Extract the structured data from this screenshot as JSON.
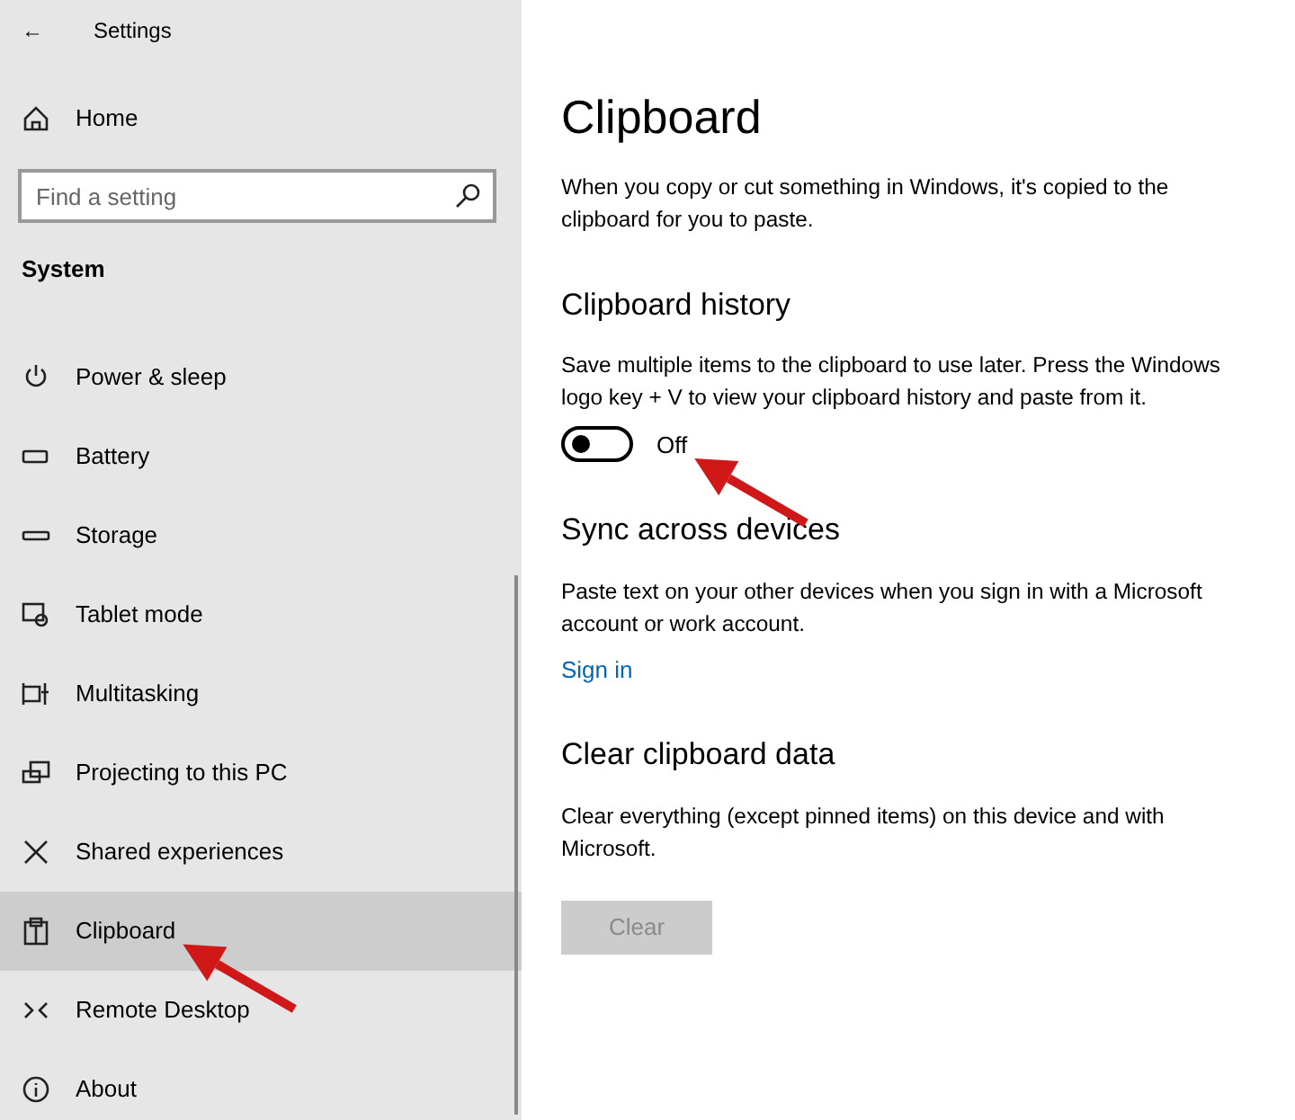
{
  "window": {
    "title": "Settings",
    "back": "←"
  },
  "sidebar": {
    "home": "Home",
    "search": {
      "placeholder": "Find a setting"
    },
    "section": "System",
    "items": [
      {
        "label": "Power & sleep",
        "selected": false
      },
      {
        "label": "Battery",
        "selected": false
      },
      {
        "label": "Storage",
        "selected": false
      },
      {
        "label": "Tablet mode",
        "selected": false
      },
      {
        "label": "Multitasking",
        "selected": false
      },
      {
        "label": "Projecting to this PC",
        "selected": false
      },
      {
        "label": "Shared experiences",
        "selected": false
      },
      {
        "label": "Clipboard",
        "selected": true,
        "callout": true
      },
      {
        "label": "Remote Desktop",
        "selected": false
      },
      {
        "label": "About",
        "selected": false
      }
    ]
  },
  "page": {
    "title": "Clipboard",
    "intro": "When you copy or cut something in Windows, it's copied to the clipboard for you to paste.",
    "sections": [
      {
        "kind": "toggle",
        "heading": "Clipboard history",
        "text": "Save multiple items to the clipboard to use later. Press the Windows logo key + V to view your clipboard history and paste from it.",
        "on": false,
        "state_label": "Off",
        "callout": true
      },
      {
        "kind": "link",
        "heading": "Sync across devices",
        "text": "Paste text on your other devices when you sign in with a Microsoft account or work account.",
        "link": "Sign in"
      },
      {
        "kind": "button",
        "heading": "Clear clipboard data",
        "text": "Clear everything (except pinned items) on this device and with Microsoft.",
        "button": "Clear",
        "disabled": true
      }
    ]
  }
}
